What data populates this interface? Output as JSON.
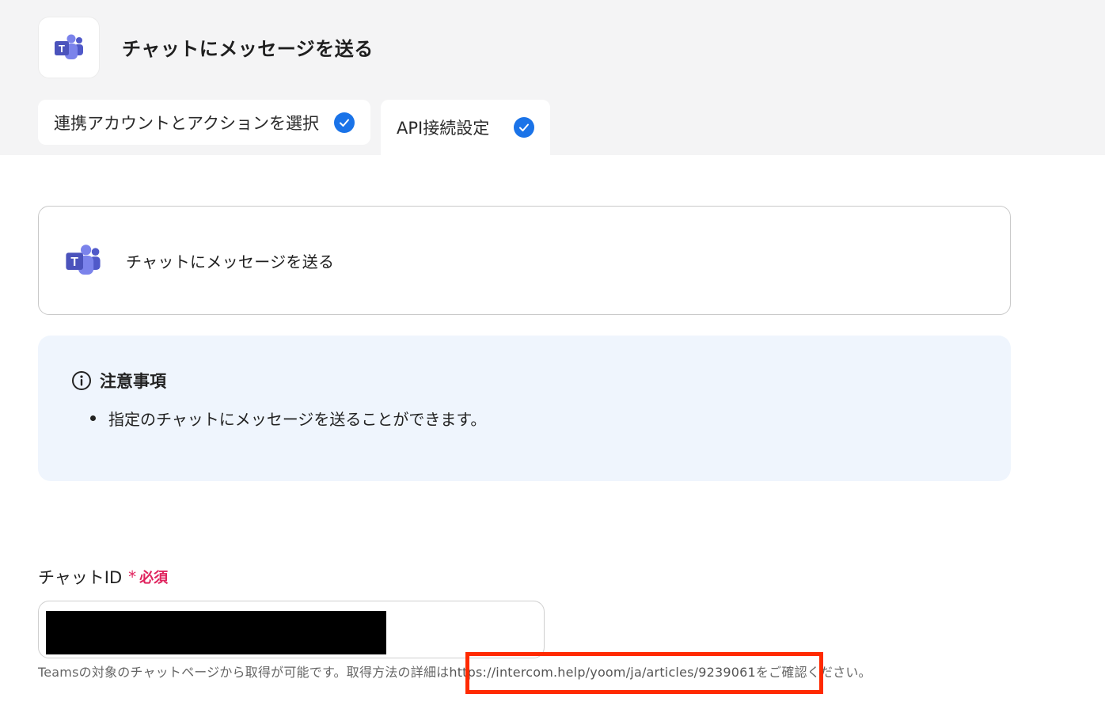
{
  "header": {
    "title": "チャットにメッセージを送る",
    "app_icon": "microsoft-teams-icon"
  },
  "tabs": [
    {
      "label": "連携アカウントとアクションを選択",
      "status_icon": "check-circle-icon",
      "active": false
    },
    {
      "label": "API接続設定",
      "status_icon": "check-circle-icon",
      "active": true
    }
  ],
  "action_card": {
    "title": "チャットにメッセージを送る",
    "icon": "microsoft-teams-icon"
  },
  "notice": {
    "heading": "注意事項",
    "icon": "info-icon",
    "items": [
      "指定のチャットにメッセージを送ることができます。"
    ]
  },
  "chat_id_field": {
    "label": "チャットID",
    "required_mark": "*",
    "required_text": "必須",
    "value_redacted": true,
    "help_prefix": "Teamsの対象のチャットページから取得が可能です。取得方法の詳細は",
    "help_link": "https://intercom.help/yoom/ja/articles/9239061",
    "help_suffix": "をご確認ください。"
  },
  "colors": {
    "accent": "#1a73e8",
    "required": "#e0245e",
    "highlight": "#ff2a00",
    "notice_bg": "#eff5fd",
    "teams_purple": "#5b5fc7"
  }
}
